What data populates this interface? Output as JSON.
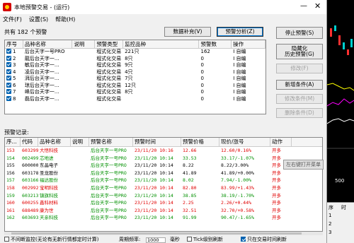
{
  "window": {
    "title": "本地预警交易 - (运行)",
    "min_glyph": "—",
    "close_glyph": "✕"
  },
  "menu": [
    "文件(F)",
    "设置(S)",
    "帮助(H)"
  ],
  "count_label": "共有 182 个预警",
  "buttons": {
    "data_export": "数据补充(V)",
    "warn_analysis": "预警分析(Z)",
    "stop_warn": "停止预警(S)",
    "hide_sys": "隐藏化\n历史预警(G)",
    "modify": "修改(F)",
    "add_condition": "新增条件(A)",
    "edit_condition": "修改条件(M)",
    "delete_condition": "删除条件(D)"
  },
  "table1": {
    "headers": [
      "序号",
      "品种名称",
      "说明",
      "预警类型",
      "监控品种",
      "预警数",
      "操作"
    ],
    "rows": [
      [
        "1",
        "后台天字一号PRO",
        "",
        "程式化交易",
        "221只",
        "162",
        "I 自编"
      ],
      [
        "2",
        "龍后台天字一...",
        "",
        "程式化交易",
        "8只",
        "0",
        "I 自编"
      ],
      [
        "3",
        "敏后台天字一...",
        "",
        "程式化交易",
        "9只",
        "0",
        "I 自编"
      ],
      [
        "4",
        "凌后台天字一...",
        "",
        "程式化交易",
        "4只",
        "0",
        "I 自编"
      ],
      [
        "5",
        "湃后台天字一...",
        "",
        "程式化交易",
        "7只",
        "0",
        "I 自编"
      ],
      [
        "6",
        "琼后台天字一...",
        "",
        "程式化交易",
        "12只",
        "0",
        "I 自编"
      ],
      [
        "7",
        "峰后台天字一...",
        "",
        "程式化交易",
        "8只",
        "0",
        "I 自编"
      ],
      [
        "8",
        "磊后台天字一...",
        "",
        "程式化交易",
        "",
        "0",
        "I 自编"
      ]
    ]
  },
  "warn_label": "预警记录:",
  "table2": {
    "headers": [
      "序...",
      "代码",
      "品种名称",
      "说明",
      "预警名称",
      "预警时间",
      "预警价格",
      "现价/涨号",
      "动作"
    ],
    "rows": [
      {
        "cells": [
          "153",
          "603299",
          "大悟科技",
          "",
          "后台天字一号PRO",
          "23/11/20 10:16",
          "12.66",
          "12.60/0.16%",
          "开多"
        ],
        "color": "red"
      },
      {
        "cells": [
          "154",
          "002499",
          "芯地进",
          "",
          "后台天字一号PRO",
          "23/11/20 10:14",
          "33.53",
          "33.17/-1.07%",
          "开多"
        ],
        "color": "green"
      },
      {
        "cells": [
          "155",
          "600000",
          "东晶电子",
          "",
          "后台天字一号PRO",
          "23/11/20 10:14",
          "8.22",
          "8.22/3.00%",
          "开多"
        ],
        "color": "black"
      },
      {
        "cells": [
          "156",
          "603178",
          "圣龙股份",
          "",
          "后台天字一号PRO",
          "23/11/20 10:14",
          "41.89",
          "41.89/+0.00%",
          "开多"
        ],
        "color": "black"
      },
      {
        "cells": [
          "157",
          "603166",
          "福达股份",
          "",
          "后台天字一号PRO",
          "23/11/20 10:14",
          "8.02",
          "7.94/-1.00%",
          "开多"
        ],
        "color": "green"
      },
      {
        "cells": [
          "158",
          "002992",
          "宝明科技",
          "",
          "后台天字一号PRO",
          "23/11/20 10:14",
          "82.80",
          "83.99/+1.43%",
          "开多"
        ],
        "color": "red"
      },
      {
        "cells": [
          "159",
          "603213",
          "镇旗科技",
          "",
          "后台天字一号PRO",
          "23/11/20 10:14",
          "38.85",
          "38.19/-1.70%",
          "开多"
        ],
        "color": "green"
      },
      {
        "cells": [
          "160",
          "600255",
          "鑫科材料",
          "",
          "后台天字一号PRO",
          "23/11/20 10:14",
          "2.25",
          "2.26/+0.44%",
          "开多"
        ],
        "color": "red"
      },
      {
        "cells": [
          "161",
          "688489",
          "康为世",
          "",
          "后台天字一号PRO",
          "23/11/20 10:14",
          "32.51",
          "32.70/+0.58%",
          "开多"
        ],
        "color": "red"
      },
      {
        "cells": [
          "162",
          "603693",
          "天亲科技",
          "",
          "后台天字一号PRO",
          "23/11/20 10:14",
          "91.99",
          "90.47/-1.65%",
          "开多"
        ],
        "color": "green"
      }
    ]
  },
  "tooltip": "左右键打开菜单",
  "footer": {
    "no_listen": "不间断监控(无论有无新行情都定时计算)",
    "calc_freq_label": "周期频率:",
    "calc_freq_value": "1000",
    "interval_label": "毫秒",
    "tick_label": "Tick级别刷新",
    "only_trade": "只在交易时间刷新"
  },
  "background": {
    "label_right": "500",
    "table_headers": [
      "序",
      "时"
    ],
    "table_rows": [
      "1",
      "2",
      "3"
    ]
  }
}
